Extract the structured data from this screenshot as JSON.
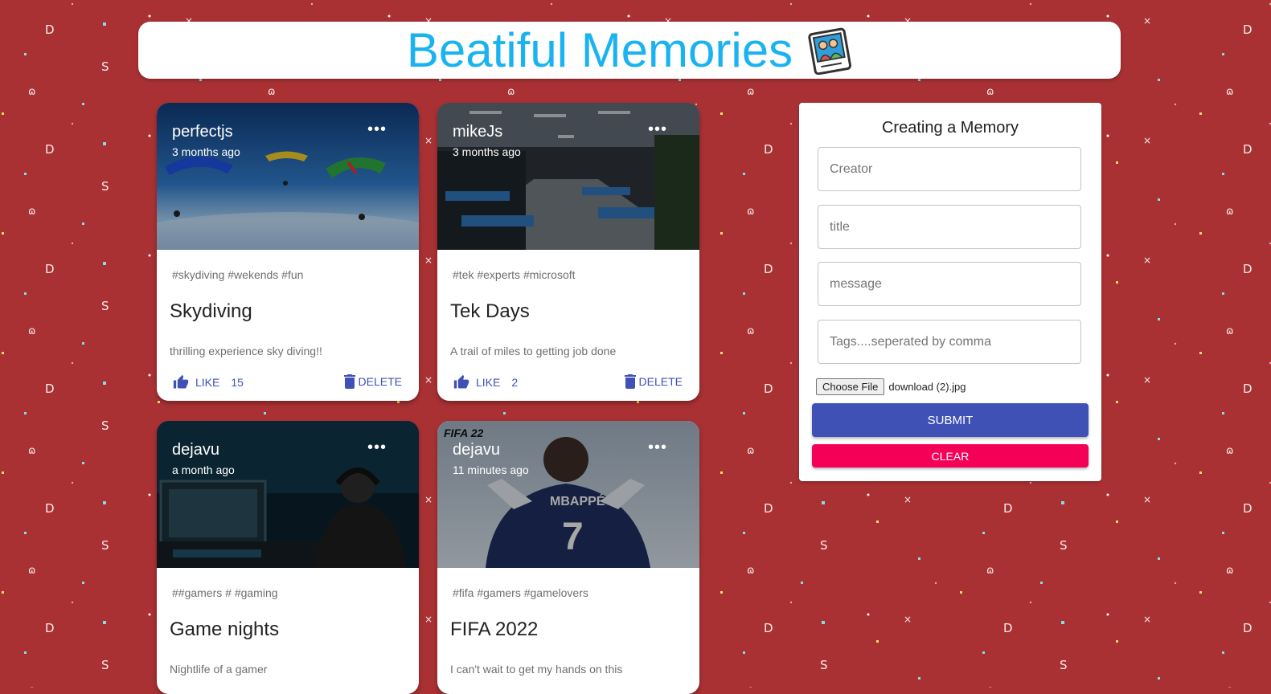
{
  "app": {
    "title": "Beatiful Memories"
  },
  "posts": [
    {
      "creator": "perfectjs",
      "time": "3 months ago",
      "tags": "#skydiving #wekends #fun",
      "title": "Skydiving",
      "message": "thrilling experience sky diving!!",
      "like_label": "LIKE",
      "likes": "15",
      "delete_label": "DELETE",
      "more": "•••"
    },
    {
      "creator": "mikeJs",
      "time": "3 months ago",
      "tags": "#tek #experts #microsoft",
      "title": "Tek Days",
      "message": "A trail of miles to getting job done",
      "like_label": "LIKE",
      "likes": "2",
      "delete_label": "DELETE",
      "more": "•••"
    },
    {
      "creator": "dejavu",
      "time": "a month ago",
      "tags": "##gamers # #gaming",
      "title": "Game nights",
      "message": "Nightlife of a gamer",
      "more": "•••"
    },
    {
      "creator": "dejavu",
      "time": "11 minutes ago",
      "tags": "#fifa #gamers #gamelovers",
      "title": "FIFA 2022",
      "message": "I can't wait to get my hands on this",
      "more": "•••",
      "image_text": {
        "game": "FIFA 22",
        "player": "MBAPPÉ",
        "number": "7"
      }
    }
  ],
  "form": {
    "heading": "Creating a Memory",
    "creator_placeholder": "Creator",
    "title_placeholder": "title",
    "message_placeholder": "message",
    "tags_placeholder": "Tags....seperated by comma",
    "choose_file_label": "Choose File",
    "file_name": "download (2).jpg",
    "submit_label": "SUBMIT",
    "clear_label": "CLEAR"
  },
  "colors": {
    "background": "#a93134",
    "title": "#1ab3f0",
    "primary": "#3f51b5",
    "secondary": "#f50057"
  },
  "icons": [
    "photo-album-icon",
    "more-horiz-icon",
    "thumb-up-icon",
    "delete-icon"
  ]
}
